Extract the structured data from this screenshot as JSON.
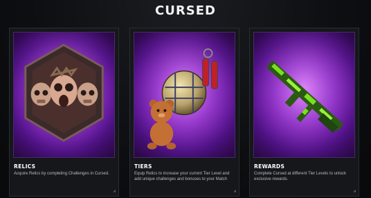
{
  "page": {
    "title": "CURSED"
  },
  "cards": [
    {
      "name": "RELICS",
      "description": "Acquire Relics by completing Challenges in Cursed.",
      "art_icon": "skull-relic-icon"
    },
    {
      "name": "TIERS",
      "description": "Equip Relics to increase your current Tier Level and add unique challenges and bonuses to your Match",
      "art_icon": "teddy-bear-orb-icon"
    },
    {
      "name": "REWARDS",
      "description": "Complete Cursed at different Tier Levels to unlock exclusive rewards.",
      "art_icon": "camo-rifle-icon"
    }
  ],
  "colors": {
    "accent_purple": "#8a27c7",
    "camo_green": "#7be020"
  }
}
